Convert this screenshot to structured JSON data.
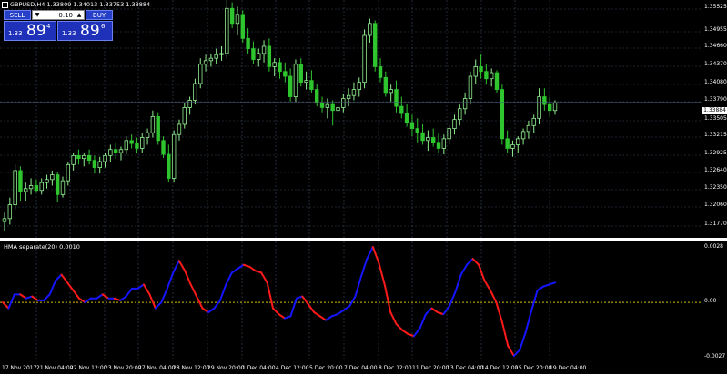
{
  "header": {
    "symbol_line": "GBPUSD,H4  1.33809 1.34013 1.33753 1.33884"
  },
  "trade_panel": {
    "sell_label": "SELL",
    "buy_label": "BUY",
    "lot_value": "0.10",
    "sell_price": {
      "prefix": "1.33",
      "big": "89",
      "sup": "4"
    },
    "buy_price": {
      "prefix": "1.33",
      "big": "89",
      "sup": "6"
    }
  },
  "price_axis": {
    "labels": [
      "1.35525",
      "1.34955",
      "1.34660",
      "1.34370",
      "1.34080",
      "1.33790",
      "1.33505",
      "1.33215",
      "1.32925",
      "1.32640",
      "1.32350",
      "1.32060",
      "1.31770"
    ],
    "current_price": "1.33884"
  },
  "indicator": {
    "title": "HMA separate(20) 0.0010",
    "labels": [
      "0.0028",
      "0.00",
      "-0.0027"
    ]
  },
  "time_axis": {
    "labels": [
      "17 Nov 2017",
      "21 Nov 04:00",
      "22 Nov 12:00",
      "23 Nov 20:00",
      "27 Nov 04:00",
      "28 Nov 12:00",
      "29 Nov 20:00",
      "1 Dec 04:00",
      "4 Dec 12:00",
      "5 Dec 20:00",
      "7 Dec 04:00",
      "8 Dec 12:00",
      "11 Dec 20:00",
      "13 Dec 04:00",
      "14 Dec 12:00",
      "15 Dec 20:00",
      "19 Dec 04:00"
    ]
  },
  "chart_data": [
    {
      "type": "candlestick",
      "title": "GBPUSD,H4",
      "ylim": [
        1.3163,
        1.3559
      ],
      "candles_ohlc": [
        [
          1.319,
          1.3205,
          1.3175,
          1.3195
        ],
        [
          1.3195,
          1.323,
          1.3185,
          1.3218
        ],
        [
          1.3218,
          1.3285,
          1.321,
          1.3275
        ],
        [
          1.3275,
          1.3282,
          1.3225,
          1.324
        ],
        [
          1.324,
          1.3255,
          1.3225,
          1.3245
        ],
        [
          1.3245,
          1.3262,
          1.3235,
          1.325
        ],
        [
          1.325,
          1.326,
          1.3238,
          1.3242
        ],
        [
          1.3242,
          1.3262,
          1.3235,
          1.3255
        ],
        [
          1.3255,
          1.3268,
          1.3245,
          1.326
        ],
        [
          1.326,
          1.3275,
          1.325,
          1.3268
        ],
        [
          1.3268,
          1.3272,
          1.3222,
          1.3235
        ],
        [
          1.3235,
          1.3265,
          1.323,
          1.3258
        ],
        [
          1.3258,
          1.329,
          1.325,
          1.3285
        ],
        [
          1.3285,
          1.3305,
          1.3275,
          1.33
        ],
        [
          1.33,
          1.331,
          1.3285,
          1.3295
        ],
        [
          1.3295,
          1.3305,
          1.3282,
          1.33
        ],
        [
          1.33,
          1.331,
          1.3285,
          1.3292
        ],
        [
          1.3292,
          1.33,
          1.327,
          1.328
        ],
        [
          1.328,
          1.3298,
          1.327,
          1.329
        ],
        [
          1.329,
          1.3305,
          1.328,
          1.33
        ],
        [
          1.33,
          1.3318,
          1.329,
          1.331
        ],
        [
          1.331,
          1.3322,
          1.3295,
          1.3305
        ],
        [
          1.3305,
          1.3315,
          1.3292,
          1.331
        ],
        [
          1.331,
          1.3332,
          1.3302,
          1.3325
        ],
        [
          1.3325,
          1.3335,
          1.3312,
          1.332
        ],
        [
          1.332,
          1.333,
          1.3305,
          1.3312
        ],
        [
          1.3312,
          1.3338,
          1.3305,
          1.333
        ],
        [
          1.333,
          1.3345,
          1.3318,
          1.3338
        ],
        [
          1.3338,
          1.3375,
          1.333,
          1.3365
        ],
        [
          1.3365,
          1.3372,
          1.3318,
          1.3325
        ],
        [
          1.3325,
          1.3332,
          1.3296,
          1.3302
        ],
        [
          1.3302,
          1.3318,
          1.3256,
          1.3262
        ],
        [
          1.3262,
          1.3342,
          1.3255,
          1.3335
        ],
        [
          1.3335,
          1.336,
          1.3325,
          1.3352
        ],
        [
          1.3352,
          1.3388,
          1.3345,
          1.338
        ],
        [
          1.338,
          1.3398,
          1.3368,
          1.3392
        ],
        [
          1.3392,
          1.3428,
          1.3385,
          1.342
        ],
        [
          1.342,
          1.3462,
          1.3412,
          1.3452
        ],
        [
          1.3452,
          1.3468,
          1.344,
          1.3458
        ],
        [
          1.3458,
          1.347,
          1.3448,
          1.3462
        ],
        [
          1.3462,
          1.3478,
          1.3452,
          1.3468
        ],
        [
          1.3468,
          1.3482,
          1.3458,
          1.347
        ],
        [
          1.347,
          1.356,
          1.3462,
          1.3545
        ],
        [
          1.3545,
          1.3555,
          1.3512,
          1.352
        ],
        [
          1.352,
          1.3548,
          1.35,
          1.3535
        ],
        [
          1.3535,
          1.3542,
          1.3488,
          1.3495
        ],
        [
          1.3495,
          1.3512,
          1.347,
          1.3478
        ],
        [
          1.3478,
          1.349,
          1.3452,
          1.346
        ],
        [
          1.346,
          1.3478,
          1.3448,
          1.347
        ],
        [
          1.347,
          1.3492,
          1.3455,
          1.3482
        ],
        [
          1.3482,
          1.3495,
          1.344,
          1.3448
        ],
        [
          1.3448,
          1.3462,
          1.3432,
          1.3455
        ],
        [
          1.3455,
          1.3462,
          1.3428,
          1.344
        ],
        [
          1.344,
          1.3455,
          1.3422,
          1.3432
        ],
        [
          1.3432,
          1.3445,
          1.339,
          1.3398
        ],
        [
          1.3398,
          1.346,
          1.339,
          1.3452
        ],
        [
          1.3452,
          1.3462,
          1.3415,
          1.3422
        ],
        [
          1.3422,
          1.344,
          1.341,
          1.3425
        ],
        [
          1.3425,
          1.3442,
          1.3405,
          1.341
        ],
        [
          1.341,
          1.342,
          1.3382,
          1.3388
        ],
        [
          1.3388,
          1.3398,
          1.3372,
          1.338
        ],
        [
          1.338,
          1.3395,
          1.3362,
          1.3385
        ],
        [
          1.3385,
          1.3392,
          1.335,
          1.3375
        ],
        [
          1.3375,
          1.3388,
          1.3362,
          1.338
        ],
        [
          1.338,
          1.3402,
          1.3372,
          1.3395
        ],
        [
          1.3395,
          1.3412,
          1.3382,
          1.34
        ],
        [
          1.34,
          1.3422,
          1.3392,
          1.341
        ],
        [
          1.341,
          1.343,
          1.3398,
          1.3422
        ],
        [
          1.3422,
          1.351,
          1.3412,
          1.35
        ],
        [
          1.35,
          1.3528,
          1.3488,
          1.352
        ],
        [
          1.352,
          1.3525,
          1.344,
          1.3448
        ],
        [
          1.3448,
          1.3462,
          1.3422,
          1.343
        ],
        [
          1.343,
          1.344,
          1.3398,
          1.3405
        ],
        [
          1.3405,
          1.3418,
          1.339,
          1.341
        ],
        [
          1.341,
          1.3425,
          1.3372,
          1.3382
        ],
        [
          1.3382,
          1.3398,
          1.3362,
          1.337
        ],
        [
          1.337,
          1.3385,
          1.3348,
          1.3355
        ],
        [
          1.3355,
          1.3368,
          1.3332,
          1.3345
        ],
        [
          1.3345,
          1.3362,
          1.3322,
          1.3338
        ],
        [
          1.3338,
          1.3352,
          1.3318,
          1.3325
        ],
        [
          1.3325,
          1.3342,
          1.3308,
          1.333
        ],
        [
          1.333,
          1.3345,
          1.3315,
          1.3322
        ],
        [
          1.3322,
          1.3338,
          1.3305,
          1.3312
        ],
        [
          1.3312,
          1.3335,
          1.3302,
          1.3328
        ],
        [
          1.3328,
          1.335,
          1.3318,
          1.3345
        ],
        [
          1.3345,
          1.3368,
          1.3335,
          1.336
        ],
        [
          1.336,
          1.3385,
          1.335,
          1.3378
        ],
        [
          1.3378,
          1.3405,
          1.3368,
          1.3395
        ],
        [
          1.3395,
          1.344,
          1.3385,
          1.3432
        ],
        [
          1.3432,
          1.346,
          1.342,
          1.3448
        ],
        [
          1.3448,
          1.3468,
          1.3428,
          1.344
        ],
        [
          1.344,
          1.3452,
          1.3418,
          1.3428
        ],
        [
          1.3428,
          1.3445,
          1.3415,
          1.3438
        ],
        [
          1.3438,
          1.3442,
          1.3405,
          1.341
        ],
        [
          1.341,
          1.3418,
          1.3318,
          1.3328
        ],
        [
          1.3328,
          1.3342,
          1.3305,
          1.3312
        ],
        [
          1.3312,
          1.3325,
          1.3298,
          1.3318
        ],
        [
          1.3318,
          1.3332,
          1.3305,
          1.3328
        ],
        [
          1.3328,
          1.3345,
          1.3318,
          1.334
        ],
        [
          1.334,
          1.3358,
          1.3328,
          1.335
        ],
        [
          1.335,
          1.3368,
          1.3338,
          1.3362
        ],
        [
          1.3362,
          1.3412,
          1.3352,
          1.3398
        ],
        [
          1.3398,
          1.3412,
          1.3375,
          1.3385
        ],
        [
          1.3385,
          1.3398,
          1.3365,
          1.3375
        ],
        [
          1.3375,
          1.3392,
          1.3368,
          1.3388
        ]
      ]
    },
    {
      "type": "line",
      "title": "HMA separate(20) 0.0010",
      "ylim": [
        -0.0027,
        0.0028
      ],
      "series": [
        {
          "values": [
            0.0,
            -0.0003,
            0.0004,
            0.0004,
            0.0002,
            0.0003,
            0.0001,
            0.0001,
            0.0004,
            0.0011,
            0.0014,
            0.001,
            0.0006,
            0.0002,
            0.0,
            0.0002,
            0.0002,
            0.0004,
            0.0002,
            0.0002,
            0.0001,
            0.0003,
            0.0007,
            0.0007,
            0.0009,
            0.0004,
            -0.0003,
            0.0,
            0.0007,
            0.0015,
            0.0021,
            0.0016,
            0.0009,
            0.0003,
            -0.0003,
            -0.0005,
            -0.0003,
            0.0001,
            0.0009,
            0.0015,
            0.0017,
            0.0019,
            0.0018,
            0.0016,
            0.0015,
            0.001,
            -0.0003,
            -0.0006,
            -0.0008,
            -0.0007,
            0.0002,
            0.0003,
            -0.0001,
            -0.0005,
            -0.0007,
            -0.0009,
            -0.0007,
            -0.0006,
            -0.0004,
            -0.0002,
            0.0003,
            0.0013,
            0.0022,
            0.0028,
            0.002,
            0.0009,
            -0.0005,
            -0.0011,
            -0.0014,
            -0.0016,
            -0.0017,
            -0.0013,
            -0.0006,
            -0.0003,
            -0.0005,
            -0.0006,
            -0.0002,
            0.0005,
            0.0014,
            0.0019,
            0.0022,
            0.0019,
            0.0011,
            0.0006,
            0.0,
            -0.001,
            -0.0022,
            -0.0027,
            -0.0024,
            -0.0015,
            -0.0004,
            0.0006,
            0.0008,
            0.0009,
            0.001
          ]
        }
      ],
      "zero_line": 0.0,
      "colors": {
        "rising": "#1515ff",
        "falling": "#ff1a1a",
        "zero": "#d8c000"
      }
    }
  ],
  "colors": {
    "bull": "#90ee90",
    "bear": "#2ec52e",
    "grid": "#3a4a5c",
    "accent": "#2740c8"
  }
}
